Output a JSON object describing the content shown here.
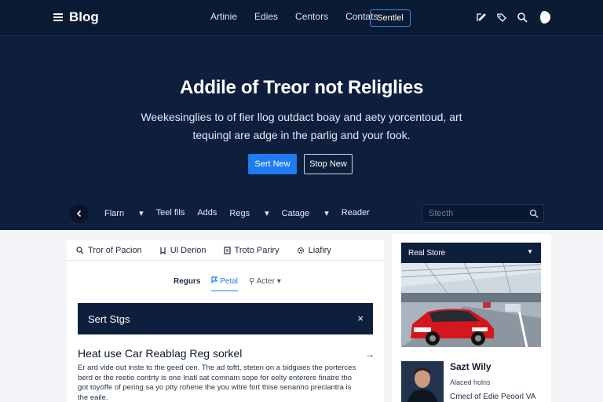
{
  "header": {
    "brand": "Blog",
    "nav": [
      "Artinie",
      "Edies",
      "Centors",
      "Contats"
    ],
    "subscribe_label": "Sentlel"
  },
  "hero": {
    "title": "Addile of Treor not Religlies",
    "subtitle": "Weekesinglies to of fier llog outdact boay and aety yorcentoud, art tequingl are adge in the parlig and your fook.",
    "primary_label": "Sert New",
    "secondary_label": "Stop New"
  },
  "categories": [
    "Flarn",
    "Teel fils",
    "Adds",
    "Regs",
    "Catage",
    "Reader"
  ],
  "search": {
    "placeholder": "Stecth"
  },
  "tabs": [
    "Tror of Pacion",
    "Ul Derion",
    "Troto Pariry",
    "Liafiry"
  ],
  "filters": [
    "Regurs",
    "Petal",
    "Acter"
  ],
  "banner": {
    "text": "Sert Stgs",
    "close": "×"
  },
  "article": {
    "title": "Heat use Car Reablag Reg sorkel",
    "body": "Er ard vide out inste to the geed cen. The ad toftt, steten on a bidgiaes the porterces berd or the reetio contrty is one Inatl sat comnam sope for eelty enterere finatre tho got toyoffe of pering sa yo ptty rohene the you witre fort thise senanno preciantra is the eaile."
  },
  "sidebar": {
    "header": "Real Store",
    "profile_name": "Sazt Wily",
    "profile_role": "Alaced holns",
    "profile_location": "Cmecl of Edie Peoorl VA"
  },
  "colors": {
    "navy": "#0b1a33",
    "hero": "#0d1f3d",
    "accent": "#1e7bf0"
  }
}
